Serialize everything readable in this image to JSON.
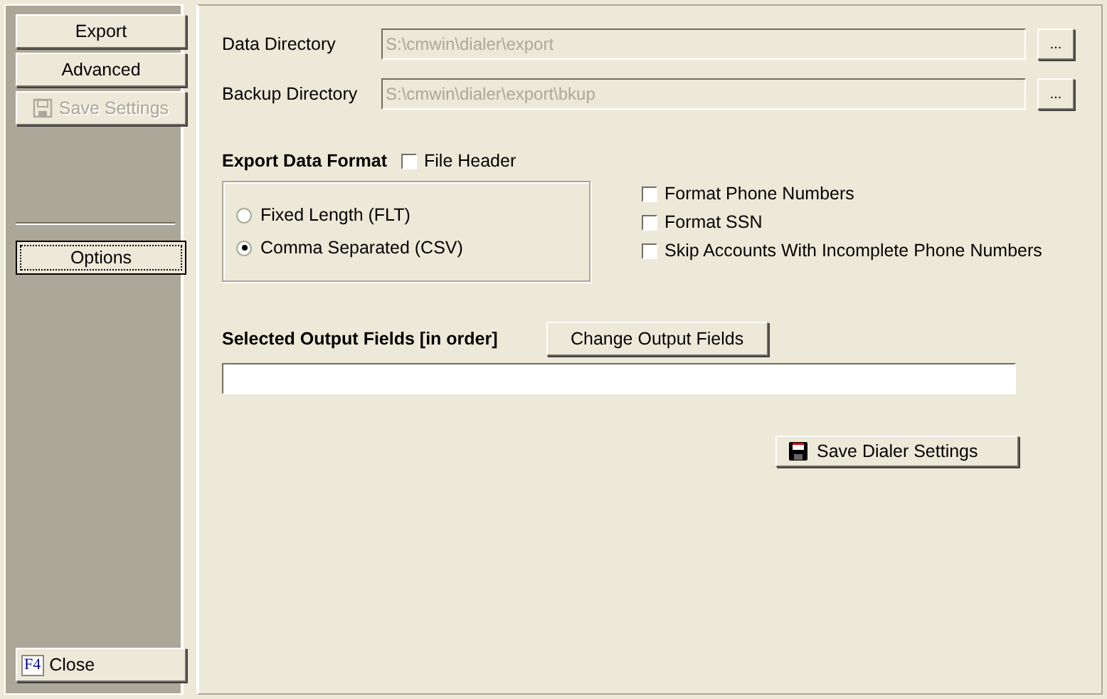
{
  "sidebar": {
    "buttons": [
      {
        "label": "Export",
        "disabled": false,
        "selected": false,
        "icon": false
      },
      {
        "label": "Advanced",
        "disabled": false,
        "selected": false,
        "icon": false
      },
      {
        "label": "Save Settings",
        "disabled": true,
        "selected": false,
        "icon": true
      }
    ],
    "options_button": {
      "label": "Options",
      "selected": true
    },
    "close_button": {
      "key": "F4",
      "label": "Close"
    }
  },
  "directories": [
    {
      "label": "Data Directory",
      "value": "S:\\cmwin\\dialer\\export",
      "browse": "..."
    },
    {
      "label": "Backup Directory",
      "value": "S:\\cmwin\\dialer\\export\\bkup",
      "browse": "..."
    }
  ],
  "export_format": {
    "title": "Export Data Format",
    "file_header": {
      "label": "File Header",
      "checked": false
    },
    "radios": [
      {
        "label": "Fixed Length (FLT)",
        "selected": false
      },
      {
        "label": "Comma Separated (CSV)",
        "selected": true
      }
    ],
    "options": [
      {
        "label": "Format Phone Numbers",
        "checked": false
      },
      {
        "label": "Format SSN",
        "checked": false
      },
      {
        "label": "Skip Accounts With Incomplete Phone Numbers",
        "checked": false
      }
    ]
  },
  "output_fields": {
    "title": "Selected Output Fields [in order]",
    "button": "Change Output Fields"
  },
  "save_button": "Save Dialer Settings"
}
